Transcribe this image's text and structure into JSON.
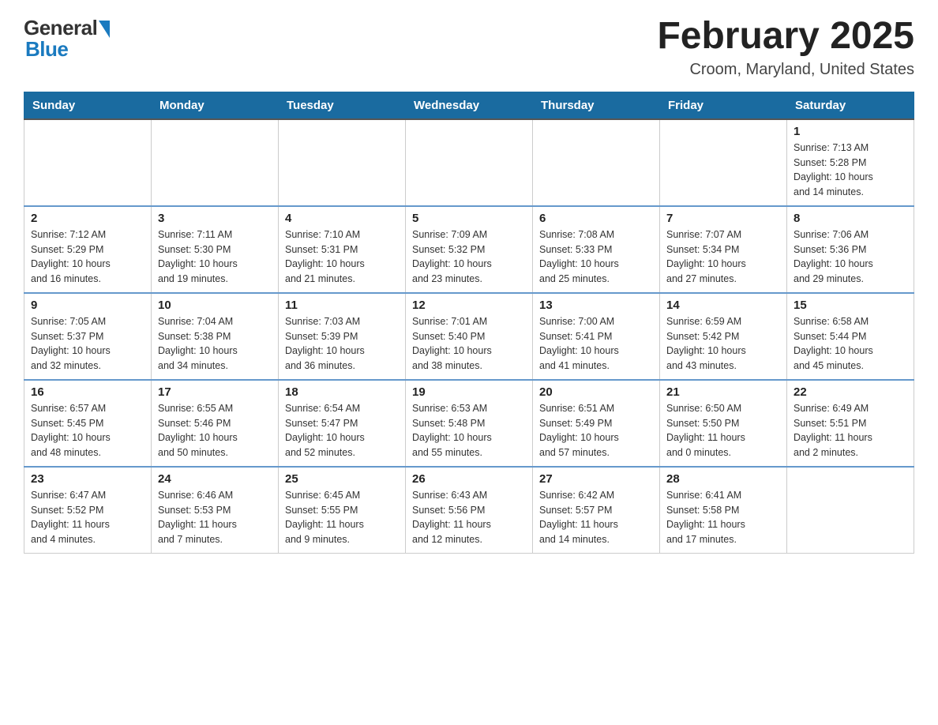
{
  "header": {
    "logo_general": "General",
    "logo_blue": "Blue",
    "month_title": "February 2025",
    "location": "Croom, Maryland, United States"
  },
  "weekdays": [
    "Sunday",
    "Monday",
    "Tuesday",
    "Wednesday",
    "Thursday",
    "Friday",
    "Saturday"
  ],
  "weeks": [
    [
      {
        "day": "",
        "info": ""
      },
      {
        "day": "",
        "info": ""
      },
      {
        "day": "",
        "info": ""
      },
      {
        "day": "",
        "info": ""
      },
      {
        "day": "",
        "info": ""
      },
      {
        "day": "",
        "info": ""
      },
      {
        "day": "1",
        "info": "Sunrise: 7:13 AM\nSunset: 5:28 PM\nDaylight: 10 hours\nand 14 minutes."
      }
    ],
    [
      {
        "day": "2",
        "info": "Sunrise: 7:12 AM\nSunset: 5:29 PM\nDaylight: 10 hours\nand 16 minutes."
      },
      {
        "day": "3",
        "info": "Sunrise: 7:11 AM\nSunset: 5:30 PM\nDaylight: 10 hours\nand 19 minutes."
      },
      {
        "day": "4",
        "info": "Sunrise: 7:10 AM\nSunset: 5:31 PM\nDaylight: 10 hours\nand 21 minutes."
      },
      {
        "day": "5",
        "info": "Sunrise: 7:09 AM\nSunset: 5:32 PM\nDaylight: 10 hours\nand 23 minutes."
      },
      {
        "day": "6",
        "info": "Sunrise: 7:08 AM\nSunset: 5:33 PM\nDaylight: 10 hours\nand 25 minutes."
      },
      {
        "day": "7",
        "info": "Sunrise: 7:07 AM\nSunset: 5:34 PM\nDaylight: 10 hours\nand 27 minutes."
      },
      {
        "day": "8",
        "info": "Sunrise: 7:06 AM\nSunset: 5:36 PM\nDaylight: 10 hours\nand 29 minutes."
      }
    ],
    [
      {
        "day": "9",
        "info": "Sunrise: 7:05 AM\nSunset: 5:37 PM\nDaylight: 10 hours\nand 32 minutes."
      },
      {
        "day": "10",
        "info": "Sunrise: 7:04 AM\nSunset: 5:38 PM\nDaylight: 10 hours\nand 34 minutes."
      },
      {
        "day": "11",
        "info": "Sunrise: 7:03 AM\nSunset: 5:39 PM\nDaylight: 10 hours\nand 36 minutes."
      },
      {
        "day": "12",
        "info": "Sunrise: 7:01 AM\nSunset: 5:40 PM\nDaylight: 10 hours\nand 38 minutes."
      },
      {
        "day": "13",
        "info": "Sunrise: 7:00 AM\nSunset: 5:41 PM\nDaylight: 10 hours\nand 41 minutes."
      },
      {
        "day": "14",
        "info": "Sunrise: 6:59 AM\nSunset: 5:42 PM\nDaylight: 10 hours\nand 43 minutes."
      },
      {
        "day": "15",
        "info": "Sunrise: 6:58 AM\nSunset: 5:44 PM\nDaylight: 10 hours\nand 45 minutes."
      }
    ],
    [
      {
        "day": "16",
        "info": "Sunrise: 6:57 AM\nSunset: 5:45 PM\nDaylight: 10 hours\nand 48 minutes."
      },
      {
        "day": "17",
        "info": "Sunrise: 6:55 AM\nSunset: 5:46 PM\nDaylight: 10 hours\nand 50 minutes."
      },
      {
        "day": "18",
        "info": "Sunrise: 6:54 AM\nSunset: 5:47 PM\nDaylight: 10 hours\nand 52 minutes."
      },
      {
        "day": "19",
        "info": "Sunrise: 6:53 AM\nSunset: 5:48 PM\nDaylight: 10 hours\nand 55 minutes."
      },
      {
        "day": "20",
        "info": "Sunrise: 6:51 AM\nSunset: 5:49 PM\nDaylight: 10 hours\nand 57 minutes."
      },
      {
        "day": "21",
        "info": "Sunrise: 6:50 AM\nSunset: 5:50 PM\nDaylight: 11 hours\nand 0 minutes."
      },
      {
        "day": "22",
        "info": "Sunrise: 6:49 AM\nSunset: 5:51 PM\nDaylight: 11 hours\nand 2 minutes."
      }
    ],
    [
      {
        "day": "23",
        "info": "Sunrise: 6:47 AM\nSunset: 5:52 PM\nDaylight: 11 hours\nand 4 minutes."
      },
      {
        "day": "24",
        "info": "Sunrise: 6:46 AM\nSunset: 5:53 PM\nDaylight: 11 hours\nand 7 minutes."
      },
      {
        "day": "25",
        "info": "Sunrise: 6:45 AM\nSunset: 5:55 PM\nDaylight: 11 hours\nand 9 minutes."
      },
      {
        "day": "26",
        "info": "Sunrise: 6:43 AM\nSunset: 5:56 PM\nDaylight: 11 hours\nand 12 minutes."
      },
      {
        "day": "27",
        "info": "Sunrise: 6:42 AM\nSunset: 5:57 PM\nDaylight: 11 hours\nand 14 minutes."
      },
      {
        "day": "28",
        "info": "Sunrise: 6:41 AM\nSunset: 5:58 PM\nDaylight: 11 hours\nand 17 minutes."
      },
      {
        "day": "",
        "info": ""
      }
    ]
  ]
}
